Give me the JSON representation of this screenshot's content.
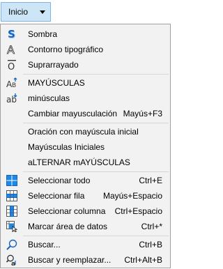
{
  "menu": {
    "title": "Inicio"
  },
  "items": [
    {
      "label": "Sombra",
      "shortcut": ""
    },
    {
      "label": "Contorno tipográfico",
      "shortcut": ""
    },
    {
      "label": "Suprarrayado",
      "shortcut": ""
    },
    {
      "label": "MAYÚSCULAS",
      "shortcut": ""
    },
    {
      "label": "minúsculas",
      "shortcut": ""
    },
    {
      "label": "Cambiar mayusculación",
      "shortcut": "Mayús+F3"
    },
    {
      "label": "Oración con mayúscula inicial",
      "shortcut": ""
    },
    {
      "label": "Mayúsculas Iniciales",
      "shortcut": ""
    },
    {
      "label": "aLTERNAR mAYÚSCULAS",
      "shortcut": ""
    },
    {
      "label": "Seleccionar todo",
      "shortcut": "Ctrl+E"
    },
    {
      "label": "Seleccionar fila",
      "shortcut": "Mayús+Espacio"
    },
    {
      "label": "Seleccionar columna",
      "shortcut": "Ctrl+Espacio"
    },
    {
      "label": "Marcar área de datos",
      "shortcut": "Ctrl+*"
    },
    {
      "label": "Buscar...",
      "shortcut": "Ctrl+B"
    },
    {
      "label": "Buscar y reemplazar...",
      "shortcut": "Ctrl+Alt+B"
    }
  ],
  "colors": {
    "accent": "#0b6cc5",
    "hover_bg": "#cde6f7",
    "hover_border": "#7eb4ea",
    "menu_bg": "#f2f2f2"
  }
}
